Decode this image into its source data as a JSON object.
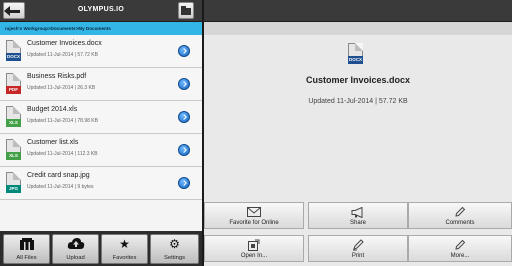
{
  "app": {
    "title": "OLYMPUS.IO"
  },
  "breadcrumb": "rajesh's Workgroup>Documents>My Documents",
  "files": [
    {
      "name": "Customer Invoices.docx",
      "meta": "Updated 11-Jul-2014 | 57.72 KB",
      "tag": "DOCX",
      "tag_color": "#1e4f91"
    },
    {
      "name": "Business Risks.pdf",
      "meta": "Updated 11-Jul-2014 | 26.3 KB",
      "tag": "PDF",
      "tag_color": "#c62828"
    },
    {
      "name": "Budget 2014.xls",
      "meta": "Updated 11-Jul-2014 | 78.98 KB",
      "tag": "XLS",
      "tag_color": "#43a047"
    },
    {
      "name": "Customer list.xls",
      "meta": "Updated 11-Jul-2014 | 112.3 KB",
      "tag": "XLS",
      "tag_color": "#43a047"
    },
    {
      "name": "Credit card snap.jpg",
      "meta": "Updated 11-Jul-2014 | 9 bytes",
      "tag": "JPG",
      "tag_color": "#00897b"
    }
  ],
  "nav": {
    "all_files": "All Files",
    "upload": "Upload",
    "favorites": "Favorites",
    "settings": "Settings"
  },
  "detail": {
    "name": "Customer Invoices.docx",
    "meta": "Updated 11-Jul-2014 | 57.72 KB",
    "tag": "DOCX"
  },
  "actions": {
    "favorite": "Favorite for Online",
    "share": "Share",
    "comments": "Comments",
    "open_in": "Open In...",
    "print": "Print",
    "more": "More..."
  }
}
